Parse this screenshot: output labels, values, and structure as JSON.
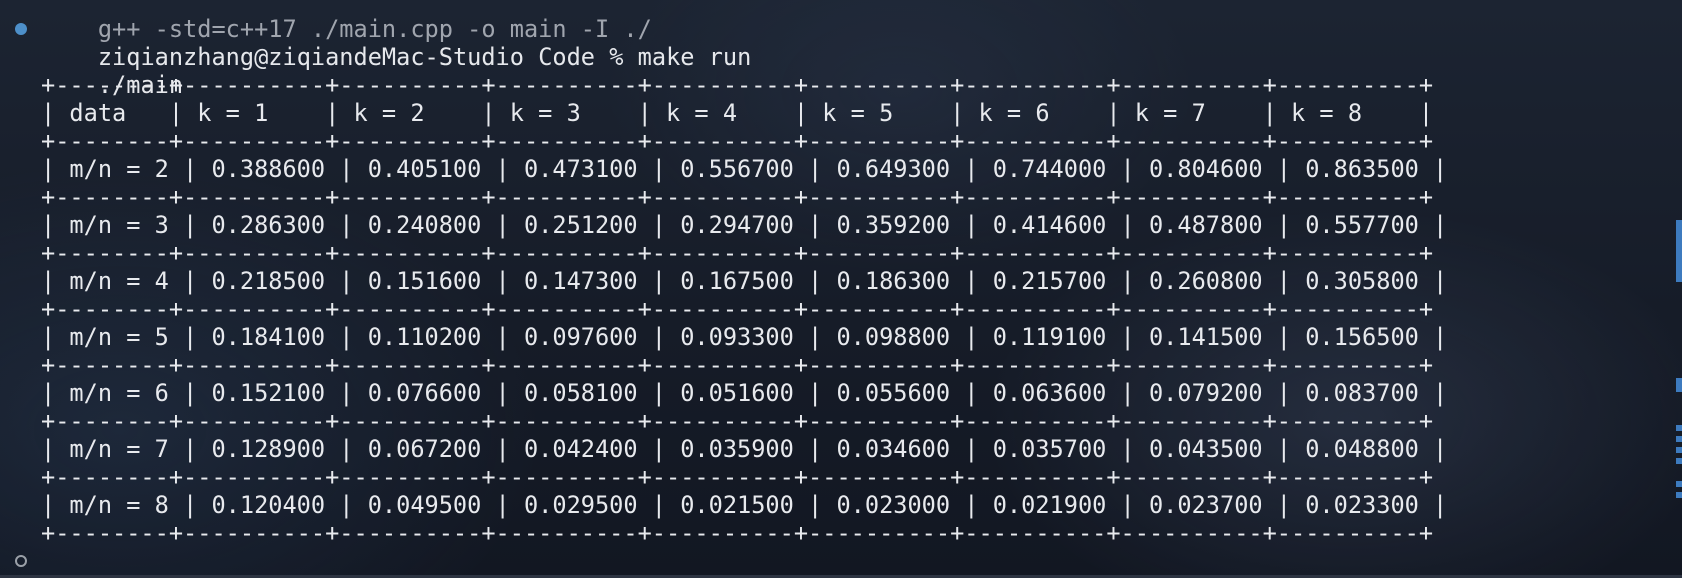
{
  "terminal": {
    "partial_line": "g++ -std=c++17 ./main.cpp -o main -I ./",
    "prompt_user": "ziqianzhang@ziqiandeMac-Studio",
    "prompt_dir": "Code",
    "prompt_symbol": "%",
    "command": "make run",
    "command_echo": "./main",
    "table": {
      "border": "+--------+----------+----------+----------+----------+----------+----------+----------+----------+",
      "header_row": "| data   | k = 1    | k = 2    | k = 3    | k = 4    | k = 5    | k = 6    | k = 7    | k = 8    |",
      "rows": [
        "| m/n = 2 | 0.388600 | 0.405100 | 0.473100 | 0.556700 | 0.649300 | 0.744000 | 0.804600 | 0.863500 |",
        "| m/n = 3 | 0.286300 | 0.240800 | 0.251200 | 0.294700 | 0.359200 | 0.414600 | 0.487800 | 0.557700 |",
        "| m/n = 4 | 0.218500 | 0.151600 | 0.147300 | 0.167500 | 0.186300 | 0.215700 | 0.260800 | 0.305800 |",
        "| m/n = 5 | 0.184100 | 0.110200 | 0.097600 | 0.093300 | 0.098800 | 0.119100 | 0.141500 | 0.156500 |",
        "| m/n = 6 | 0.152100 | 0.076600 | 0.058100 | 0.051600 | 0.055600 | 0.063600 | 0.079200 | 0.083700 |",
        "| m/n = 7 | 0.128900 | 0.067200 | 0.042400 | 0.035900 | 0.034600 | 0.035700 | 0.043500 | 0.048800 |",
        "| m/n = 8 | 0.120400 | 0.049500 | 0.029500 | 0.021500 | 0.023000 | 0.021900 | 0.023700 | 0.023300 |"
      ]
    }
  },
  "colors": {
    "success_dot": "#4d8fc9",
    "pending_dot": "#9aa0a8",
    "scroll_marker": "#3d7bbf"
  },
  "icons": {
    "command_status": "filled-circle",
    "prompt_status": "hollow-circle"
  }
}
